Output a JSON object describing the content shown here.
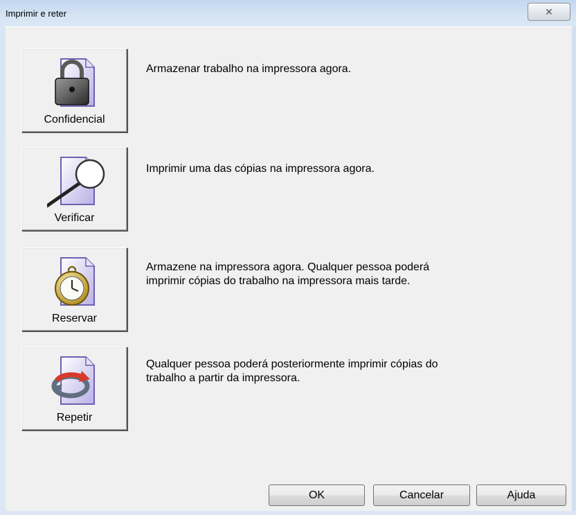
{
  "window": {
    "title": "Imprimir e reter",
    "close_glyph": "✕"
  },
  "options": [
    {
      "label": "Confidencial",
      "icon": "lock-document-icon",
      "description": "Armazenar trabalho na impressora agora."
    },
    {
      "label": "Verificar",
      "icon": "magnifier-document-icon",
      "description": "Imprimir uma das cópias na impressora agora."
    },
    {
      "label": "Reservar",
      "icon": "stopwatch-document-icon",
      "description_lines": [
        "Armazene na impressora agora. Qualquer pessoa poderá",
        "imprimir cópias do trabalho na impressora mais tarde."
      ]
    },
    {
      "label": "Repetir",
      "icon": "repeat-arrows-document-icon",
      "description_lines": [
        "Qualquer pessoa poderá posteriormente imprimir cópias do",
        "trabalho a partir da impressora."
      ]
    }
  ],
  "buttons": {
    "ok": "OK",
    "cancel": "Cancelar",
    "help": "Ajuda"
  }
}
